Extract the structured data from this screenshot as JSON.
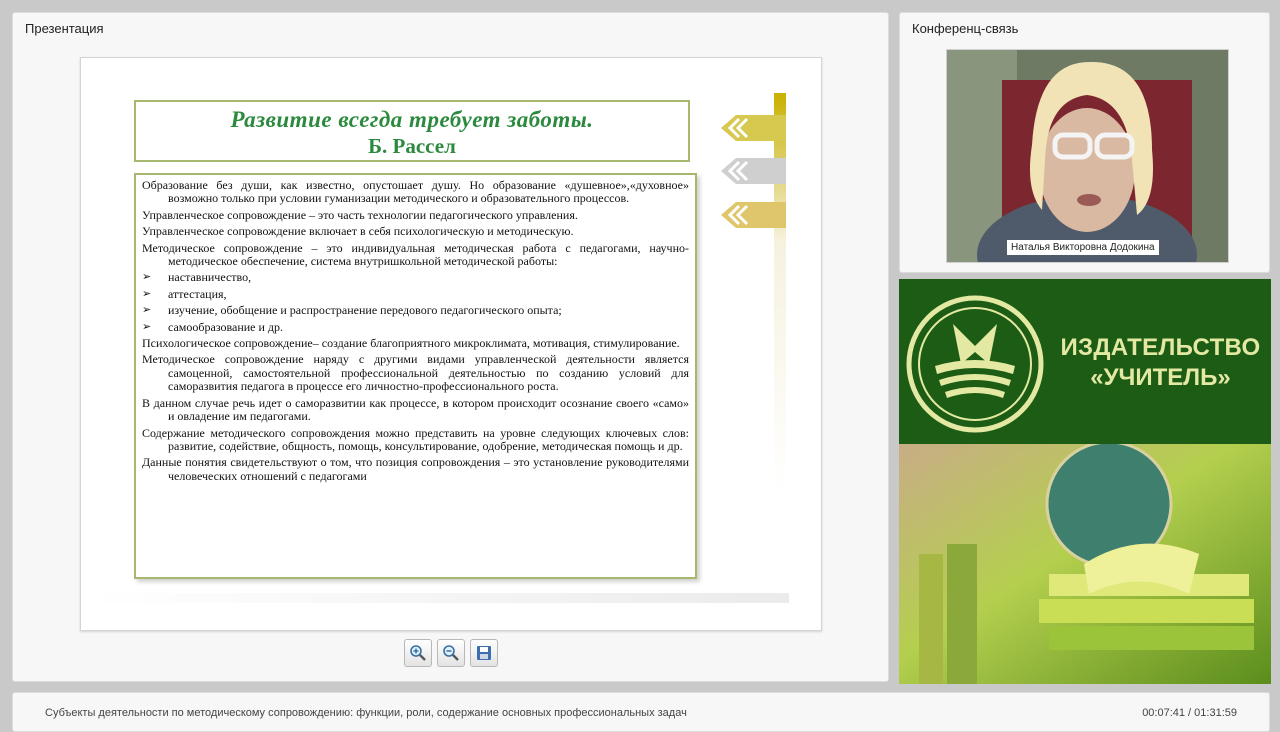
{
  "presentation_panel": {
    "title": "Презентация"
  },
  "conference_panel": {
    "title": "Конференц-связь",
    "participant_name": "Наталья Викторовна Додокина"
  },
  "slide": {
    "title_line1": "Развитие всегда требует заботы.",
    "title_line2": "Б. Рассел",
    "paragraphs": [
      "Образование без души, как известно, опустошает душу. Но образование «душевное»,«духовное» возможно только при условии гуманизации методического и образовательного процессов.",
      "Управленческое сопровождение – это часть технологии педагогического управления.",
      "Управленческое сопровождение  включает в себя психологическую и методическую.",
      "Методическое сопровождение – это индивидуальная методическая работа с педагогами, научно-методическое обеспечение, система внутришкольной методической работы:"
    ],
    "bullets": [
      "наставничество,",
      "аттестация,",
      "изучение, обобщение и распространение передового педагогического опыта;",
      "самообразование и др."
    ],
    "bullet_marker": "➢",
    "paragraphs2": [
      "Психологическое сопровождение– создание благоприятного микроклимата, мотивация, стимулирование.",
      "Методическое сопровождение  наряду с другими видами управленческой деятельности является самоценной, самостоятельной профессиональной деятельностью по созданию условий для саморазвития педагога в процессе его личностно-профессионального роста.",
      "В данном случае речь идет о саморазвитии как процессе, в котором происходит осознание своего «само» и овладение им педагогами.",
      "Содержание методического сопровождения можно представить на уровне следующих ключевых слов: развитие, содействие, общность, помощь, консультирование, одобрение, методическая помощь и др.",
      "Данные понятия свидетельствуют о том, что позиция сопровождения – это установление руководителями человеческих отношений с педагогами"
    ]
  },
  "controls": {
    "zoom_in": "zoom-in-icon",
    "zoom_out": "zoom-out-icon",
    "save": "save-icon"
  },
  "promo": {
    "line1": "ИЗДАТЕЛЬСТВО",
    "line2": "«УЧИТЕЛЬ»"
  },
  "footer": {
    "lecture_title": "Субъекты деятельности по методическому сопровождению: функции, роли, содержание основных профессиональных задач",
    "time": "00:07:41 / 01:31:59"
  },
  "colors": {
    "slide_title": "#2b8a3e",
    "frame": "#a6b86e",
    "promo_green": "#1d5c15",
    "promo_text": "#e3e9a2"
  }
}
